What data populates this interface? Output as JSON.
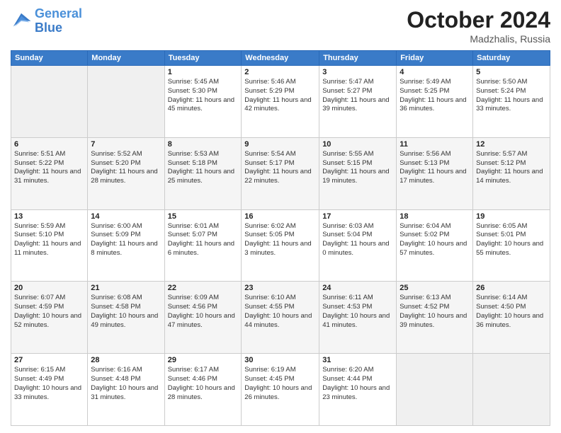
{
  "header": {
    "logo_line1": "General",
    "logo_line2": "Blue",
    "month": "October 2024",
    "location": "Madzhalis, Russia"
  },
  "weekdays": [
    "Sunday",
    "Monday",
    "Tuesday",
    "Wednesday",
    "Thursday",
    "Friday",
    "Saturday"
  ],
  "weeks": [
    [
      {
        "day": "",
        "sunrise": "",
        "sunset": "",
        "daylight": ""
      },
      {
        "day": "",
        "sunrise": "",
        "sunset": "",
        "daylight": ""
      },
      {
        "day": "1",
        "sunrise": "Sunrise: 5:45 AM",
        "sunset": "Sunset: 5:30 PM",
        "daylight": "Daylight: 11 hours and 45 minutes."
      },
      {
        "day": "2",
        "sunrise": "Sunrise: 5:46 AM",
        "sunset": "Sunset: 5:29 PM",
        "daylight": "Daylight: 11 hours and 42 minutes."
      },
      {
        "day": "3",
        "sunrise": "Sunrise: 5:47 AM",
        "sunset": "Sunset: 5:27 PM",
        "daylight": "Daylight: 11 hours and 39 minutes."
      },
      {
        "day": "4",
        "sunrise": "Sunrise: 5:49 AM",
        "sunset": "Sunset: 5:25 PM",
        "daylight": "Daylight: 11 hours and 36 minutes."
      },
      {
        "day": "5",
        "sunrise": "Sunrise: 5:50 AM",
        "sunset": "Sunset: 5:24 PM",
        "daylight": "Daylight: 11 hours and 33 minutes."
      }
    ],
    [
      {
        "day": "6",
        "sunrise": "Sunrise: 5:51 AM",
        "sunset": "Sunset: 5:22 PM",
        "daylight": "Daylight: 11 hours and 31 minutes."
      },
      {
        "day": "7",
        "sunrise": "Sunrise: 5:52 AM",
        "sunset": "Sunset: 5:20 PM",
        "daylight": "Daylight: 11 hours and 28 minutes."
      },
      {
        "day": "8",
        "sunrise": "Sunrise: 5:53 AM",
        "sunset": "Sunset: 5:18 PM",
        "daylight": "Daylight: 11 hours and 25 minutes."
      },
      {
        "day": "9",
        "sunrise": "Sunrise: 5:54 AM",
        "sunset": "Sunset: 5:17 PM",
        "daylight": "Daylight: 11 hours and 22 minutes."
      },
      {
        "day": "10",
        "sunrise": "Sunrise: 5:55 AM",
        "sunset": "Sunset: 5:15 PM",
        "daylight": "Daylight: 11 hours and 19 minutes."
      },
      {
        "day": "11",
        "sunrise": "Sunrise: 5:56 AM",
        "sunset": "Sunset: 5:13 PM",
        "daylight": "Daylight: 11 hours and 17 minutes."
      },
      {
        "day": "12",
        "sunrise": "Sunrise: 5:57 AM",
        "sunset": "Sunset: 5:12 PM",
        "daylight": "Daylight: 11 hours and 14 minutes."
      }
    ],
    [
      {
        "day": "13",
        "sunrise": "Sunrise: 5:59 AM",
        "sunset": "Sunset: 5:10 PM",
        "daylight": "Daylight: 11 hours and 11 minutes."
      },
      {
        "day": "14",
        "sunrise": "Sunrise: 6:00 AM",
        "sunset": "Sunset: 5:09 PM",
        "daylight": "Daylight: 11 hours and 8 minutes."
      },
      {
        "day": "15",
        "sunrise": "Sunrise: 6:01 AM",
        "sunset": "Sunset: 5:07 PM",
        "daylight": "Daylight: 11 hours and 6 minutes."
      },
      {
        "day": "16",
        "sunrise": "Sunrise: 6:02 AM",
        "sunset": "Sunset: 5:05 PM",
        "daylight": "Daylight: 11 hours and 3 minutes."
      },
      {
        "day": "17",
        "sunrise": "Sunrise: 6:03 AM",
        "sunset": "Sunset: 5:04 PM",
        "daylight": "Daylight: 11 hours and 0 minutes."
      },
      {
        "day": "18",
        "sunrise": "Sunrise: 6:04 AM",
        "sunset": "Sunset: 5:02 PM",
        "daylight": "Daylight: 10 hours and 57 minutes."
      },
      {
        "day": "19",
        "sunrise": "Sunrise: 6:05 AM",
        "sunset": "Sunset: 5:01 PM",
        "daylight": "Daylight: 10 hours and 55 minutes."
      }
    ],
    [
      {
        "day": "20",
        "sunrise": "Sunrise: 6:07 AM",
        "sunset": "Sunset: 4:59 PM",
        "daylight": "Daylight: 10 hours and 52 minutes."
      },
      {
        "day": "21",
        "sunrise": "Sunrise: 6:08 AM",
        "sunset": "Sunset: 4:58 PM",
        "daylight": "Daylight: 10 hours and 49 minutes."
      },
      {
        "day": "22",
        "sunrise": "Sunrise: 6:09 AM",
        "sunset": "Sunset: 4:56 PM",
        "daylight": "Daylight: 10 hours and 47 minutes."
      },
      {
        "day": "23",
        "sunrise": "Sunrise: 6:10 AM",
        "sunset": "Sunset: 4:55 PM",
        "daylight": "Daylight: 10 hours and 44 minutes."
      },
      {
        "day": "24",
        "sunrise": "Sunrise: 6:11 AM",
        "sunset": "Sunset: 4:53 PM",
        "daylight": "Daylight: 10 hours and 41 minutes."
      },
      {
        "day": "25",
        "sunrise": "Sunrise: 6:13 AM",
        "sunset": "Sunset: 4:52 PM",
        "daylight": "Daylight: 10 hours and 39 minutes."
      },
      {
        "day": "26",
        "sunrise": "Sunrise: 6:14 AM",
        "sunset": "Sunset: 4:50 PM",
        "daylight": "Daylight: 10 hours and 36 minutes."
      }
    ],
    [
      {
        "day": "27",
        "sunrise": "Sunrise: 6:15 AM",
        "sunset": "Sunset: 4:49 PM",
        "daylight": "Daylight: 10 hours and 33 minutes."
      },
      {
        "day": "28",
        "sunrise": "Sunrise: 6:16 AM",
        "sunset": "Sunset: 4:48 PM",
        "daylight": "Daylight: 10 hours and 31 minutes."
      },
      {
        "day": "29",
        "sunrise": "Sunrise: 6:17 AM",
        "sunset": "Sunset: 4:46 PM",
        "daylight": "Daylight: 10 hours and 28 minutes."
      },
      {
        "day": "30",
        "sunrise": "Sunrise: 6:19 AM",
        "sunset": "Sunset: 4:45 PM",
        "daylight": "Daylight: 10 hours and 26 minutes."
      },
      {
        "day": "31",
        "sunrise": "Sunrise: 6:20 AM",
        "sunset": "Sunset: 4:44 PM",
        "daylight": "Daylight: 10 hours and 23 minutes."
      },
      {
        "day": "",
        "sunrise": "",
        "sunset": "",
        "daylight": ""
      },
      {
        "day": "",
        "sunrise": "",
        "sunset": "",
        "daylight": ""
      }
    ]
  ]
}
